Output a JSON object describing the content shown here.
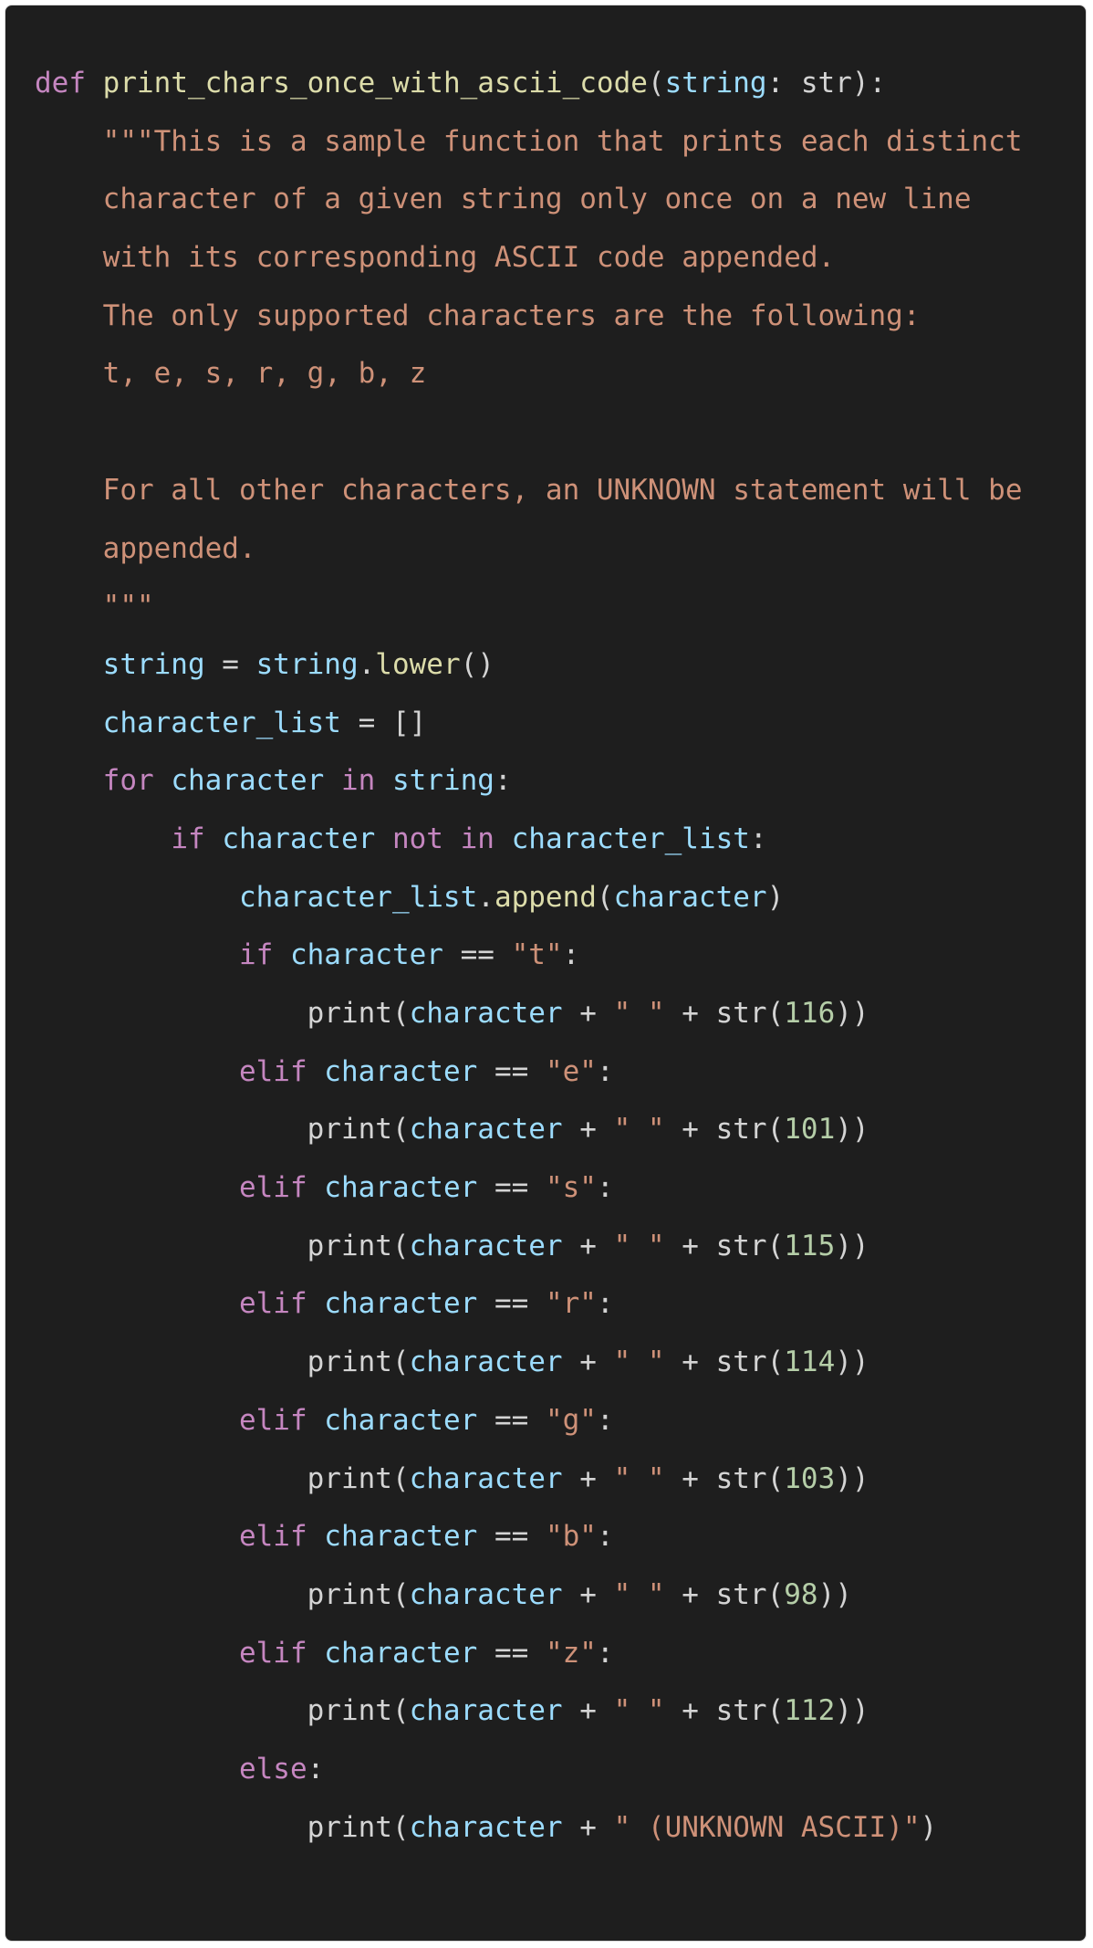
{
  "colors": {
    "panel_background": "#1e1e1e",
    "default_text": "#d4d4d4",
    "keyword": "#c586c0",
    "function": "#dcdcaa",
    "variable": "#9cdcfe",
    "string": "#ce9178",
    "number": "#b5cea8"
  },
  "code": {
    "language": "python",
    "lines": [
      [
        {
          "t": "def",
          "c": "kw"
        },
        {
          "t": " ",
          "c": "punc"
        },
        {
          "t": "print_chars_once_with_ascii_code",
          "c": "fn"
        },
        {
          "t": "(",
          "c": "punc"
        },
        {
          "t": "string",
          "c": "var"
        },
        {
          "t": ": str):",
          "c": "punc"
        }
      ],
      [
        {
          "t": "    \"\"\"This is a sample function that prints each distinct",
          "c": "str"
        }
      ],
      [
        {
          "t": "    character of a given string only once on a new line",
          "c": "str"
        }
      ],
      [
        {
          "t": "    with its corresponding ASCII code appended.",
          "c": "str"
        }
      ],
      [
        {
          "t": "    The only supported characters are the following:",
          "c": "str"
        }
      ],
      [
        {
          "t": "    t, e, s, r, g, b, z",
          "c": "str"
        }
      ],
      [
        {
          "t": "",
          "c": "punc"
        }
      ],
      [
        {
          "t": "    For all other characters, an UNKNOWN statement will be",
          "c": "str"
        }
      ],
      [
        {
          "t": "    appended.",
          "c": "str"
        }
      ],
      [
        {
          "t": "    \"\"\"",
          "c": "str"
        }
      ],
      [
        {
          "t": "    ",
          "c": "punc"
        },
        {
          "t": "string",
          "c": "var"
        },
        {
          "t": " = ",
          "c": "punc"
        },
        {
          "t": "string",
          "c": "var"
        },
        {
          "t": ".",
          "c": "punc"
        },
        {
          "t": "lower",
          "c": "fn"
        },
        {
          "t": "()",
          "c": "punc"
        }
      ],
      [
        {
          "t": "    ",
          "c": "punc"
        },
        {
          "t": "character_list",
          "c": "var"
        },
        {
          "t": " = []",
          "c": "punc"
        }
      ],
      [
        {
          "t": "    ",
          "c": "punc"
        },
        {
          "t": "for",
          "c": "kw"
        },
        {
          "t": " ",
          "c": "punc"
        },
        {
          "t": "character",
          "c": "var"
        },
        {
          "t": " ",
          "c": "punc"
        },
        {
          "t": "in",
          "c": "kw"
        },
        {
          "t": " ",
          "c": "punc"
        },
        {
          "t": "string",
          "c": "var"
        },
        {
          "t": ":",
          "c": "punc"
        }
      ],
      [
        {
          "t": "        ",
          "c": "punc"
        },
        {
          "t": "if",
          "c": "kw"
        },
        {
          "t": " ",
          "c": "punc"
        },
        {
          "t": "character",
          "c": "var"
        },
        {
          "t": " ",
          "c": "punc"
        },
        {
          "t": "not",
          "c": "kw"
        },
        {
          "t": " ",
          "c": "punc"
        },
        {
          "t": "in",
          "c": "kw"
        },
        {
          "t": " ",
          "c": "punc"
        },
        {
          "t": "character_list",
          "c": "var"
        },
        {
          "t": ":",
          "c": "punc"
        }
      ],
      [
        {
          "t": "            ",
          "c": "punc"
        },
        {
          "t": "character_list",
          "c": "var"
        },
        {
          "t": ".",
          "c": "punc"
        },
        {
          "t": "append",
          "c": "fn"
        },
        {
          "t": "(",
          "c": "punc"
        },
        {
          "t": "character",
          "c": "var"
        },
        {
          "t": ")",
          "c": "punc"
        }
      ],
      [
        {
          "t": "            ",
          "c": "punc"
        },
        {
          "t": "if",
          "c": "kw"
        },
        {
          "t": " ",
          "c": "punc"
        },
        {
          "t": "character",
          "c": "var"
        },
        {
          "t": " == ",
          "c": "punc"
        },
        {
          "t": "\"t\"",
          "c": "str"
        },
        {
          "t": ":",
          "c": "punc"
        }
      ],
      [
        {
          "t": "                print(",
          "c": "punc"
        },
        {
          "t": "character",
          "c": "var"
        },
        {
          "t": " + ",
          "c": "punc"
        },
        {
          "t": "\" \"",
          "c": "str"
        },
        {
          "t": " + str(",
          "c": "punc"
        },
        {
          "t": "116",
          "c": "num"
        },
        {
          "t": "))",
          "c": "punc"
        }
      ],
      [
        {
          "t": "            ",
          "c": "punc"
        },
        {
          "t": "elif",
          "c": "kw"
        },
        {
          "t": " ",
          "c": "punc"
        },
        {
          "t": "character",
          "c": "var"
        },
        {
          "t": " == ",
          "c": "punc"
        },
        {
          "t": "\"e\"",
          "c": "str"
        },
        {
          "t": ":",
          "c": "punc"
        }
      ],
      [
        {
          "t": "                print(",
          "c": "punc"
        },
        {
          "t": "character",
          "c": "var"
        },
        {
          "t": " + ",
          "c": "punc"
        },
        {
          "t": "\" \"",
          "c": "str"
        },
        {
          "t": " + str(",
          "c": "punc"
        },
        {
          "t": "101",
          "c": "num"
        },
        {
          "t": "))",
          "c": "punc"
        }
      ],
      [
        {
          "t": "            ",
          "c": "punc"
        },
        {
          "t": "elif",
          "c": "kw"
        },
        {
          "t": " ",
          "c": "punc"
        },
        {
          "t": "character",
          "c": "var"
        },
        {
          "t": " == ",
          "c": "punc"
        },
        {
          "t": "\"s\"",
          "c": "str"
        },
        {
          "t": ":",
          "c": "punc"
        }
      ],
      [
        {
          "t": "                print(",
          "c": "punc"
        },
        {
          "t": "character",
          "c": "var"
        },
        {
          "t": " + ",
          "c": "punc"
        },
        {
          "t": "\" \"",
          "c": "str"
        },
        {
          "t": " + str(",
          "c": "punc"
        },
        {
          "t": "115",
          "c": "num"
        },
        {
          "t": "))",
          "c": "punc"
        }
      ],
      [
        {
          "t": "            ",
          "c": "punc"
        },
        {
          "t": "elif",
          "c": "kw"
        },
        {
          "t": " ",
          "c": "punc"
        },
        {
          "t": "character",
          "c": "var"
        },
        {
          "t": " == ",
          "c": "punc"
        },
        {
          "t": "\"r\"",
          "c": "str"
        },
        {
          "t": ":",
          "c": "punc"
        }
      ],
      [
        {
          "t": "                print(",
          "c": "punc"
        },
        {
          "t": "character",
          "c": "var"
        },
        {
          "t": " + ",
          "c": "punc"
        },
        {
          "t": "\" \"",
          "c": "str"
        },
        {
          "t": " + str(",
          "c": "punc"
        },
        {
          "t": "114",
          "c": "num"
        },
        {
          "t": "))",
          "c": "punc"
        }
      ],
      [
        {
          "t": "            ",
          "c": "punc"
        },
        {
          "t": "elif",
          "c": "kw"
        },
        {
          "t": " ",
          "c": "punc"
        },
        {
          "t": "character",
          "c": "var"
        },
        {
          "t": " == ",
          "c": "punc"
        },
        {
          "t": "\"g\"",
          "c": "str"
        },
        {
          "t": ":",
          "c": "punc"
        }
      ],
      [
        {
          "t": "                print(",
          "c": "punc"
        },
        {
          "t": "character",
          "c": "var"
        },
        {
          "t": " + ",
          "c": "punc"
        },
        {
          "t": "\" \"",
          "c": "str"
        },
        {
          "t": " + str(",
          "c": "punc"
        },
        {
          "t": "103",
          "c": "num"
        },
        {
          "t": "))",
          "c": "punc"
        }
      ],
      [
        {
          "t": "            ",
          "c": "punc"
        },
        {
          "t": "elif",
          "c": "kw"
        },
        {
          "t": " ",
          "c": "punc"
        },
        {
          "t": "character",
          "c": "var"
        },
        {
          "t": " == ",
          "c": "punc"
        },
        {
          "t": "\"b\"",
          "c": "str"
        },
        {
          "t": ":",
          "c": "punc"
        }
      ],
      [
        {
          "t": "                print(",
          "c": "punc"
        },
        {
          "t": "character",
          "c": "var"
        },
        {
          "t": " + ",
          "c": "punc"
        },
        {
          "t": "\" \"",
          "c": "str"
        },
        {
          "t": " + str(",
          "c": "punc"
        },
        {
          "t": "98",
          "c": "num"
        },
        {
          "t": "))",
          "c": "punc"
        }
      ],
      [
        {
          "t": "            ",
          "c": "punc"
        },
        {
          "t": "elif",
          "c": "kw"
        },
        {
          "t": " ",
          "c": "punc"
        },
        {
          "t": "character",
          "c": "var"
        },
        {
          "t": " == ",
          "c": "punc"
        },
        {
          "t": "\"z\"",
          "c": "str"
        },
        {
          "t": ":",
          "c": "punc"
        }
      ],
      [
        {
          "t": "                print(",
          "c": "punc"
        },
        {
          "t": "character",
          "c": "var"
        },
        {
          "t": " + ",
          "c": "punc"
        },
        {
          "t": "\" \"",
          "c": "str"
        },
        {
          "t": " + str(",
          "c": "punc"
        },
        {
          "t": "112",
          "c": "num"
        },
        {
          "t": "))",
          "c": "punc"
        }
      ],
      [
        {
          "t": "            ",
          "c": "punc"
        },
        {
          "t": "else",
          "c": "kw"
        },
        {
          "t": ":",
          "c": "punc"
        }
      ],
      [
        {
          "t": "                print(",
          "c": "punc"
        },
        {
          "t": "character",
          "c": "var"
        },
        {
          "t": " + ",
          "c": "punc"
        },
        {
          "t": "\" (UNKNOWN ASCII)\"",
          "c": "str"
        },
        {
          "t": ")",
          "c": "punc"
        }
      ]
    ]
  }
}
